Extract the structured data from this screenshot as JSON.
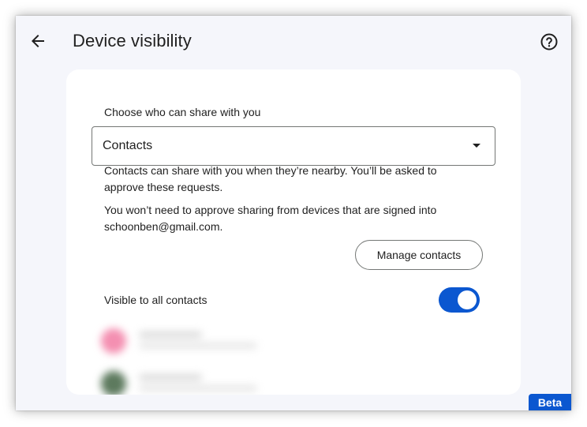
{
  "header": {
    "title": "Device visibility",
    "back_icon": "arrow-back-icon",
    "help_icon": "help-circle-icon"
  },
  "share_section": {
    "label": "Choose who can share with you",
    "selected_option": "Contacts",
    "description_1": "Contacts can share with you when they’re nearby. You’ll be asked to approve these requests.",
    "description_2": "You won’t need to approve sharing from devices that are signed into schoonben@gmail.com.",
    "manage_button": "Manage contacts"
  },
  "visibility": {
    "label": "Visible to all contacts",
    "toggle_on": true
  },
  "contacts": [
    {
      "avatar_color": "#f48fb1"
    },
    {
      "avatar_color": "#5d7a5e"
    }
  ],
  "badge": "Beta",
  "colors": {
    "accent": "#0b57d0",
    "window_background": "#f5f6fb",
    "card_background": "#ffffff",
    "text": "#1f1f1f"
  }
}
